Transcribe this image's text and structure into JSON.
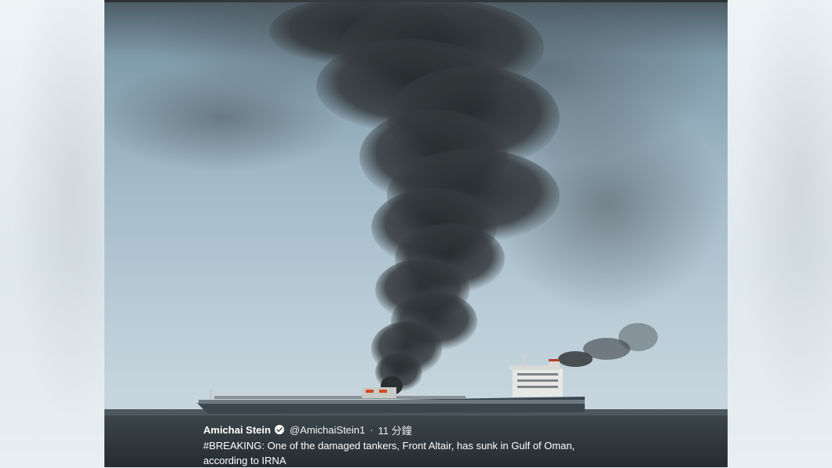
{
  "tweet": {
    "author_name": "Amichai Stein",
    "handle": "@AmichaiStein1",
    "separator": "·",
    "time": "11 分鐘",
    "text": "#BREAKING: One of the damaged tankers, Front Altair, has sunk in Gulf of Oman, according to IRNA"
  },
  "icons": {
    "verified": "verified-badge-icon"
  },
  "colors": {
    "smoke": "#2f3336",
    "sea": "#3d484e",
    "ship_hull": "#3b4650",
    "overlay_text": "#ffffff"
  }
}
